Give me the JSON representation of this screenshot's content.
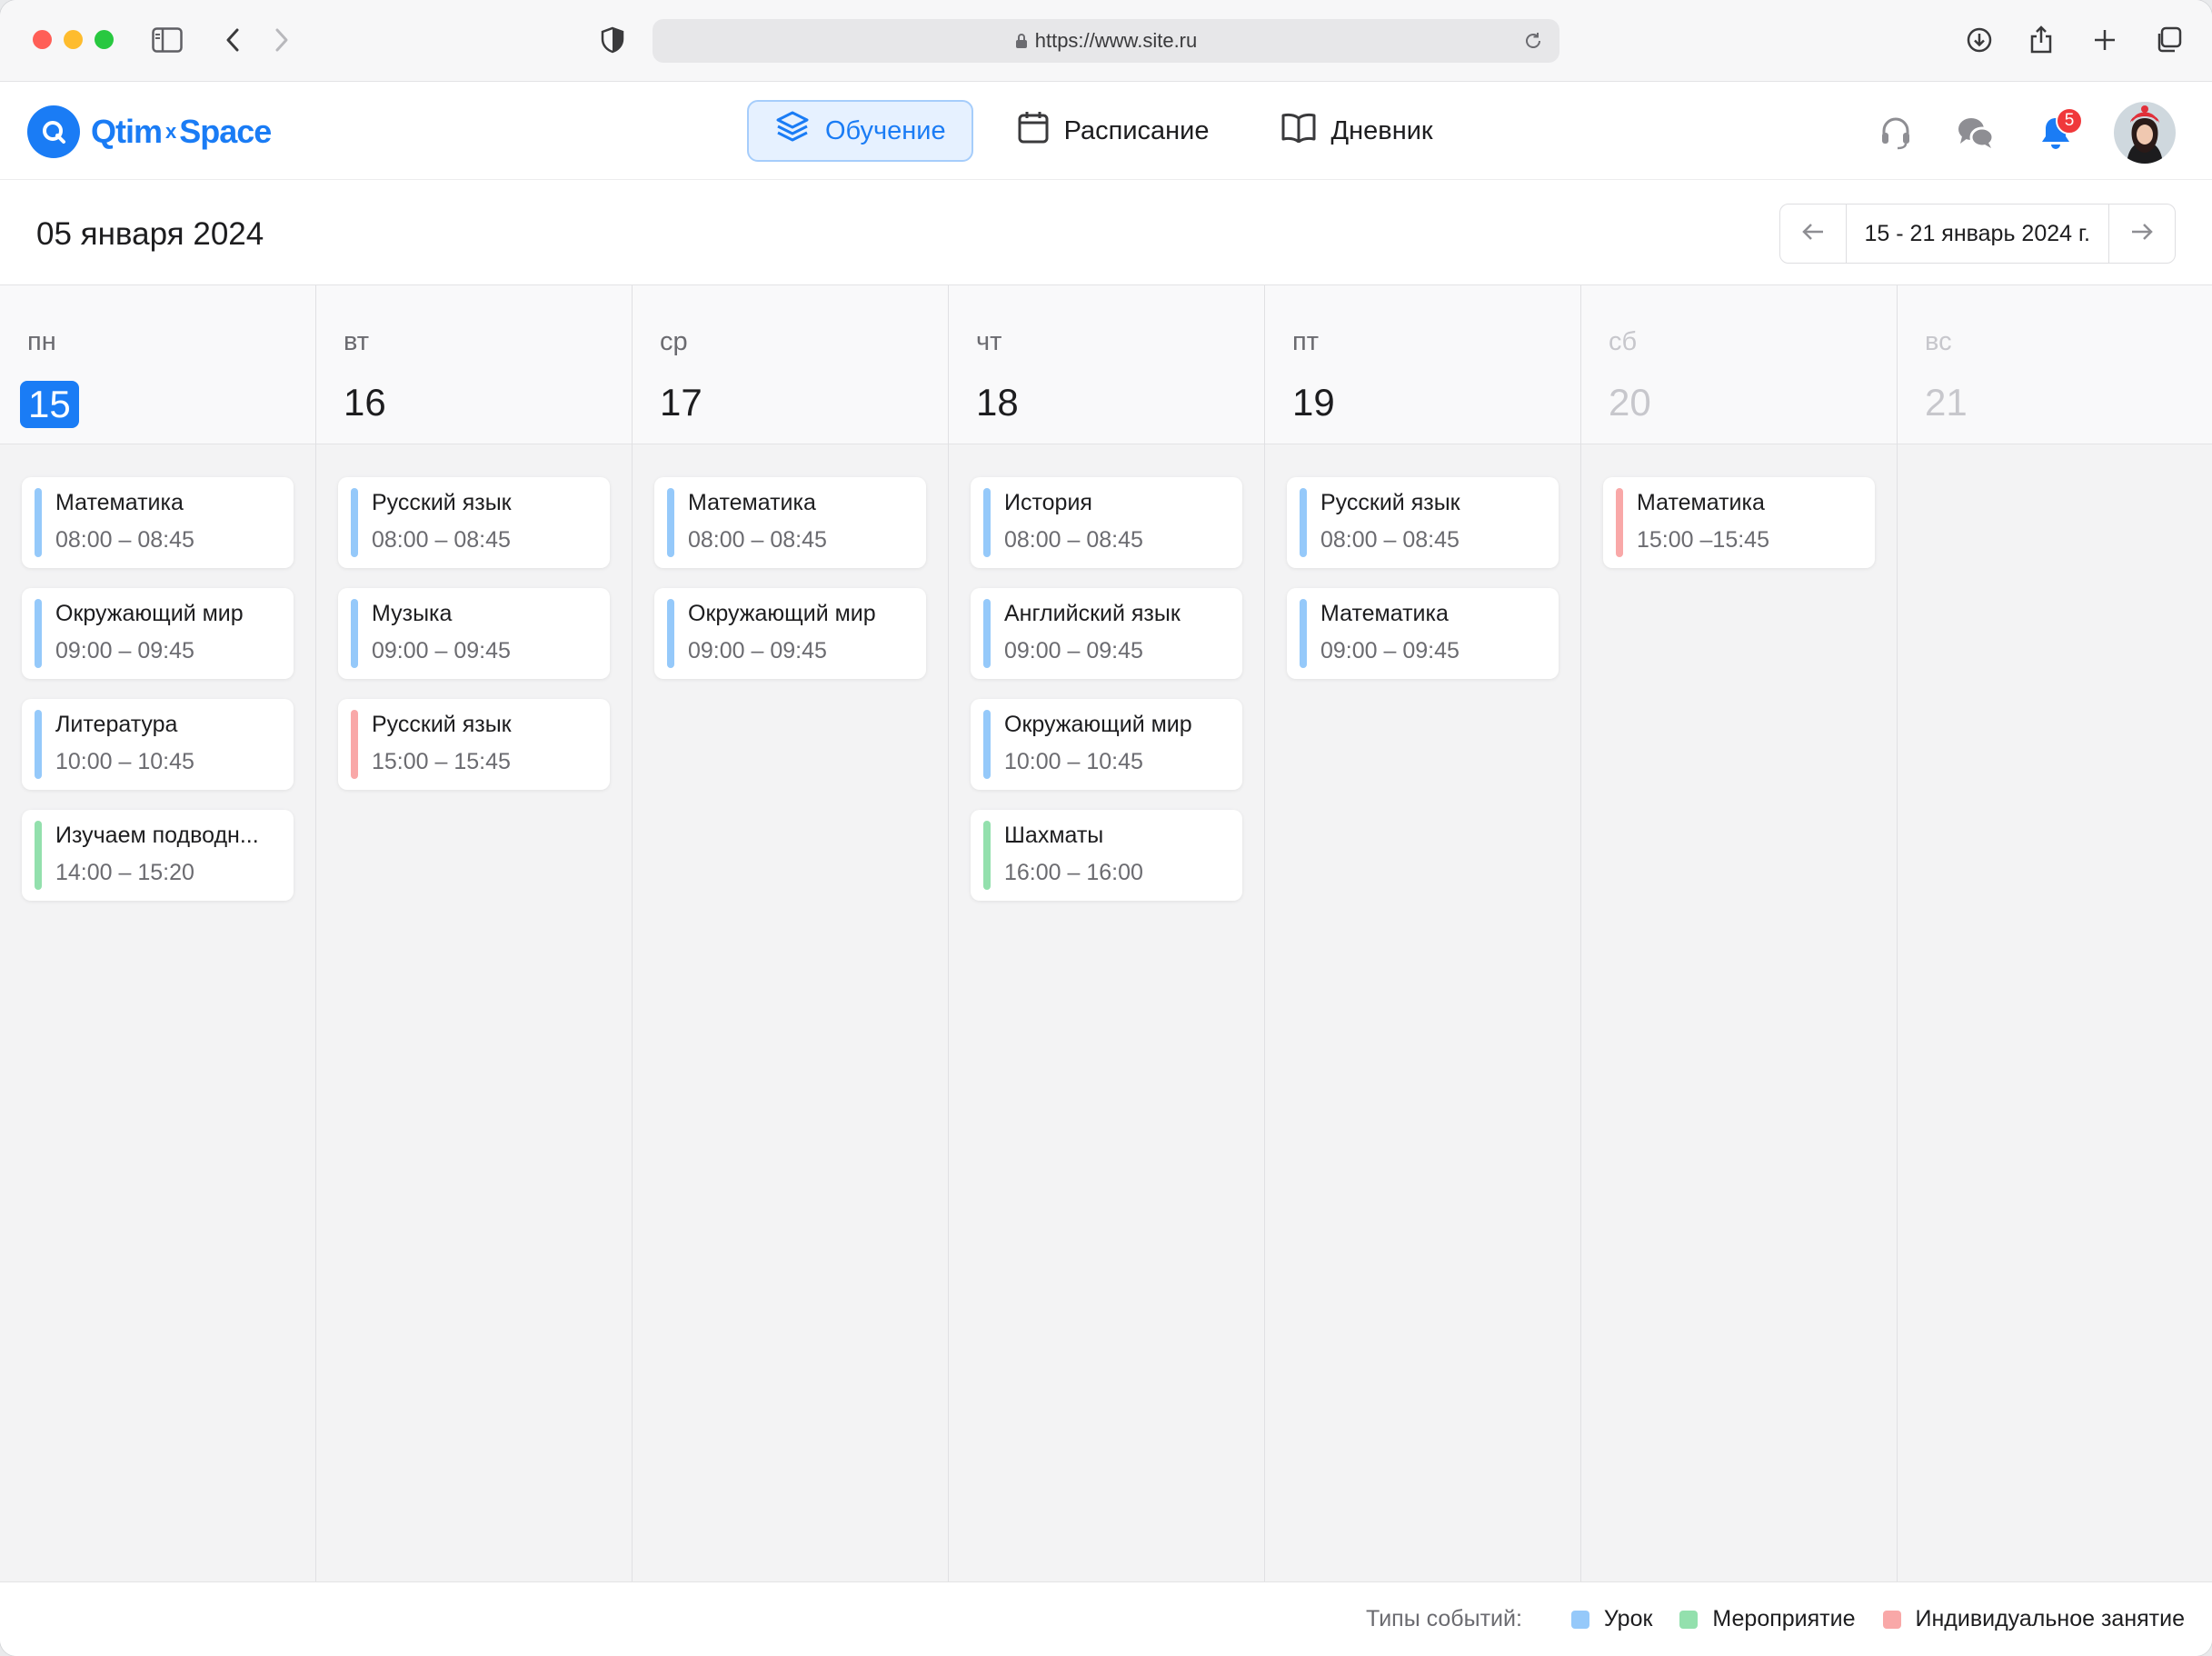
{
  "browser": {
    "url": "https://www.site.ru"
  },
  "app": {
    "logo": {
      "left": "Qtim",
      "sep": "x",
      "right": "Space"
    },
    "nav": [
      {
        "label": "Обучение",
        "icon": "layers-icon",
        "active": true
      },
      {
        "label": "Расписание",
        "icon": "calendar-icon",
        "active": false
      },
      {
        "label": "Дневник",
        "icon": "book-icon",
        "active": false
      }
    ],
    "notifications_count": "5"
  },
  "page": {
    "date": "05 января 2024",
    "range_label": "15 - 21 январь 2024 г."
  },
  "colors": {
    "lesson": "#95c9fa",
    "event": "#93e0ad",
    "individual": "#f9a8a8",
    "accent": "#1a7cf5"
  },
  "days": [
    {
      "weekday": "пн",
      "day": "15",
      "today": true,
      "weekend": false,
      "events": [
        {
          "title": "Математика",
          "time": "08:00 – 08:45",
          "type": "lesson"
        },
        {
          "title": "Окружающий мир",
          "time": "09:00 – 09:45",
          "type": "lesson"
        },
        {
          "title": "Литература",
          "time": "10:00 – 10:45",
          "type": "lesson"
        },
        {
          "title": "Изучаем подводн...",
          "time": "14:00 – 15:20",
          "type": "event"
        }
      ]
    },
    {
      "weekday": "вт",
      "day": "16",
      "today": false,
      "weekend": false,
      "events": [
        {
          "title": "Русский язык",
          "time": "08:00 – 08:45",
          "type": "lesson"
        },
        {
          "title": "Музыка",
          "time": "09:00 – 09:45",
          "type": "lesson"
        },
        {
          "title": "Русский язык",
          "time": "15:00 – 15:45",
          "type": "individual"
        }
      ]
    },
    {
      "weekday": "ср",
      "day": "17",
      "today": false,
      "weekend": false,
      "events": [
        {
          "title": "Математика",
          "time": "08:00 – 08:45",
          "type": "lesson"
        },
        {
          "title": "Окружающий мир",
          "time": "09:00 – 09:45",
          "type": "lesson"
        }
      ]
    },
    {
      "weekday": "чт",
      "day": "18",
      "today": false,
      "weekend": false,
      "events": [
        {
          "title": "История",
          "time": "08:00 – 08:45",
          "type": "lesson"
        },
        {
          "title": "Английский язык",
          "time": "09:00 – 09:45",
          "type": "lesson"
        },
        {
          "title": "Окружающий мир",
          "time": "10:00 – 10:45",
          "type": "lesson"
        },
        {
          "title": "Шахматы",
          "time": "16:00 – 16:00",
          "type": "event"
        }
      ]
    },
    {
      "weekday": "пт",
      "day": "19",
      "today": false,
      "weekend": false,
      "events": [
        {
          "title": "Русский язык",
          "time": "08:00 – 08:45",
          "type": "lesson"
        },
        {
          "title": "Математика",
          "time": "09:00 – 09:45",
          "type": "lesson"
        }
      ]
    },
    {
      "weekday": "сб",
      "day": "20",
      "today": false,
      "weekend": true,
      "events": [
        {
          "title": "Математика",
          "time": "15:00 –15:45",
          "type": "individual"
        }
      ]
    },
    {
      "weekday": "вс",
      "day": "21",
      "today": false,
      "weekend": true,
      "events": []
    }
  ],
  "legend": {
    "lead": "Типы событий:",
    "items": [
      {
        "label": "Урок",
        "type": "lesson"
      },
      {
        "label": "Мероприятие",
        "type": "event"
      },
      {
        "label": "Индивидуальное занятие",
        "type": "individual"
      }
    ]
  }
}
